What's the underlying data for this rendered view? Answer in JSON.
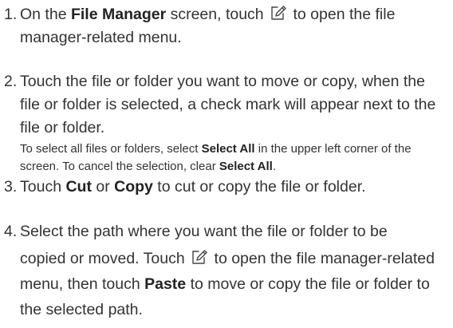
{
  "steps": [
    {
      "number": "1.",
      "t1": "On the ",
      "b1": "File Manager",
      "t2": " screen, touch ",
      "icon": "edit-menu-icon",
      "t3": " to open the file manager-related menu."
    },
    {
      "number": "2.",
      "t1": "Touch the file or folder you want to move or copy, when the file or folder is selected, a check mark will appear next to the file or folder.",
      "note": {
        "t1": "To select all files or folders, select ",
        "b1": "Select All",
        "t2": " in the upper left corner of the screen. To cancel the selection, clear ",
        "b2": "Select All",
        "t3": "."
      }
    },
    {
      "number": "3.",
      "t1": "Touch ",
      "b1": "Cut",
      "t2": " or ",
      "b2": "Copy",
      "t3": " to cut or copy the file or folder."
    },
    {
      "number": "4.",
      "t1": "Select the path where you want the file or folder to be",
      "t2": "copied or moved. Touch ",
      "icon": "edit-menu-icon",
      "t3": " to open the file manager-related menu, then touch ",
      "b1": "Paste",
      "t4": " to move or copy the file or folder to the selected path."
    }
  ]
}
